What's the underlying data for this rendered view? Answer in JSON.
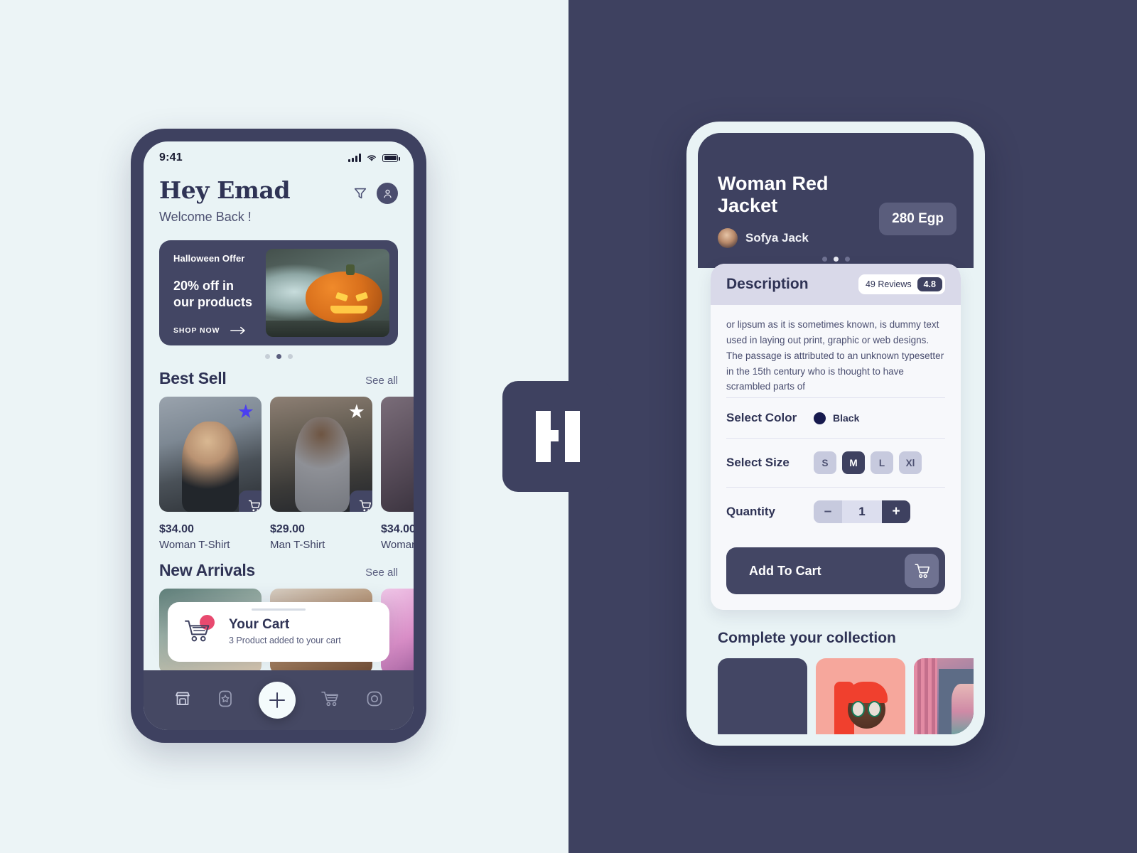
{
  "theme": {
    "bg_left": "#ecf4f6",
    "bg_right": "#3e4160",
    "navy": "#3e4160",
    "accent_blue": "#4b3ff0",
    "pink": "#e84a6f",
    "screen_bg": "#e9f3f5"
  },
  "logo": {
    "name": "h-logo-mark"
  },
  "phone1": {
    "status": {
      "time": "9:41",
      "signal_icon": "signal-bars-icon",
      "wifi_icon": "wifi-icon",
      "battery_icon": "battery-icon"
    },
    "header": {
      "greeting": "Hey Emad",
      "subtitle": "Welcome Back !",
      "filter_icon": "filter-icon",
      "profile_icon": "person-icon"
    },
    "banner": {
      "kicker": "Halloween Offer",
      "headline": "20% off in our  products",
      "cta": "SHOP NOW",
      "arrow_icon": "arrow-right-icon",
      "image_alt": "halloween-pumpkin-photo"
    },
    "banner_dots": {
      "count": 3,
      "active": 1
    },
    "best_sell": {
      "title": "Best Sell",
      "see_all": "See all",
      "products": [
        {
          "price": "$34.00",
          "name": "Woman T-Shirt",
          "star": "★",
          "star_color": "#4b3ff0",
          "cart_icon": "cart-icon"
        },
        {
          "price": "$29.00",
          "name": "Man T-Shirt",
          "star": "★",
          "star_color": "#ffffff",
          "cart_icon": "cart-icon"
        },
        {
          "price": "$34.00",
          "name": "Woman T-Shirt",
          "star": "",
          "star_color": "#ffffff",
          "cart_icon": "cart-icon"
        }
      ]
    },
    "new_arrivals": {
      "title": "New Arrivals",
      "see_all": "See all"
    },
    "cart_toast": {
      "title": "Your Cart",
      "subtitle": "3 Product added to your cart",
      "icon": "cart-badge-icon"
    },
    "tabbar": {
      "items": [
        {
          "name": "store-icon",
          "label": "Store",
          "active": true
        },
        {
          "name": "favorites-icon",
          "label": "Favorites",
          "active": false
        },
        {
          "name": "add-plus-icon",
          "label": "Add",
          "active": false
        },
        {
          "name": "cart-icon",
          "label": "Cart",
          "active": false
        },
        {
          "name": "settings-icon",
          "label": "Settings",
          "active": false
        }
      ]
    }
  },
  "phone2": {
    "hero": {
      "title": "Woman Red Jacket",
      "seller_name": "Sofya Jack",
      "seller_avatar": "avatar",
      "price": "280 Egp"
    },
    "hero_dots": {
      "count": 3,
      "active": 1
    },
    "sheet": {
      "heading": "Description",
      "reviews_label": "49 Reviews",
      "rating": "4.8",
      "body": "or lipsum as it is sometimes known, is dummy text used in laying out print, graphic or web designs. The passage is attributed to an unknown typesetter in the 15th century who is thought to have scrambled parts of",
      "color": {
        "label": "Select Color",
        "value": "Black",
        "swatch_hex": "#171a4e"
      },
      "size": {
        "label": "Select Size",
        "options": [
          "S",
          "M",
          "L",
          "Xl"
        ],
        "selected": "M"
      },
      "quantity": {
        "label": "Quantity",
        "minus": "–",
        "value": "1",
        "plus": "+"
      },
      "add_to_cart": {
        "label": "Add To Cart",
        "icon": "cart-icon"
      }
    },
    "collection": {
      "title": "Complete your collection",
      "items": [
        {
          "alt": "collection-item-placeholder"
        },
        {
          "alt": "collection-item-illustration-girl"
        },
        {
          "alt": "collection-item-interior-scene"
        }
      ]
    }
  }
}
